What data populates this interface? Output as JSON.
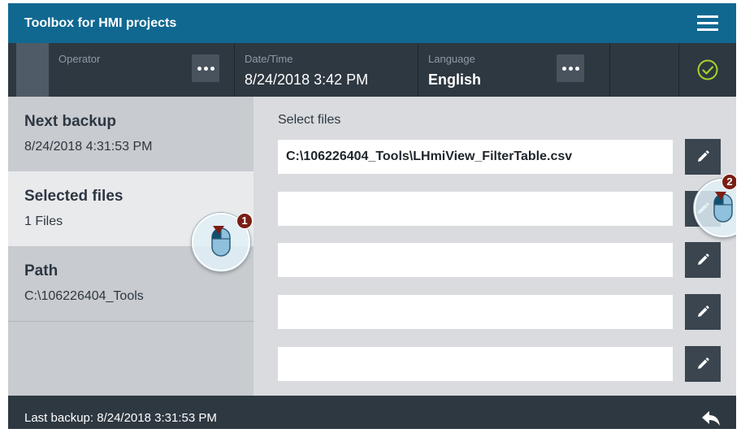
{
  "app": {
    "title": "Toolbox for HMI projects"
  },
  "status": {
    "operator_label": "Operator",
    "operator_value": "",
    "datetime_label": "Date/Time",
    "datetime_value": "8/24/2018 3:42 PM",
    "language_label": "Language",
    "language_value": "English"
  },
  "sidebar": {
    "items": [
      {
        "title": "Next backup",
        "subtitle": "8/24/2018 4:31:53 PM",
        "active": false
      },
      {
        "title": "Selected files",
        "subtitle": "1 Files",
        "active": true
      },
      {
        "title": "Path",
        "subtitle": "C:\\106226404_Tools",
        "active": false
      }
    ]
  },
  "main": {
    "header": "Select files",
    "files": [
      "C:\\106226404_Tools\\LHmiView_FilterTable.csv",
      "",
      "",
      "",
      ""
    ]
  },
  "footer": {
    "last_backup": "Last backup: 8/24/2018 3:31:53 PM"
  },
  "callouts": {
    "one": "1",
    "two": "2"
  },
  "colors": {
    "title_bar": "#106891",
    "status_bar": "#2e3841",
    "accept_check": "#a7d12b",
    "edit_button": "#3a4550",
    "badge": "#7a1e14"
  },
  "icons": {
    "menu": "hamburger-icon",
    "more": "ellipsis-icon",
    "accept": "check-circle-icon",
    "edit": "pencil-icon",
    "back": "return-arrow-icon",
    "mouse": "mouse-click-icon"
  }
}
